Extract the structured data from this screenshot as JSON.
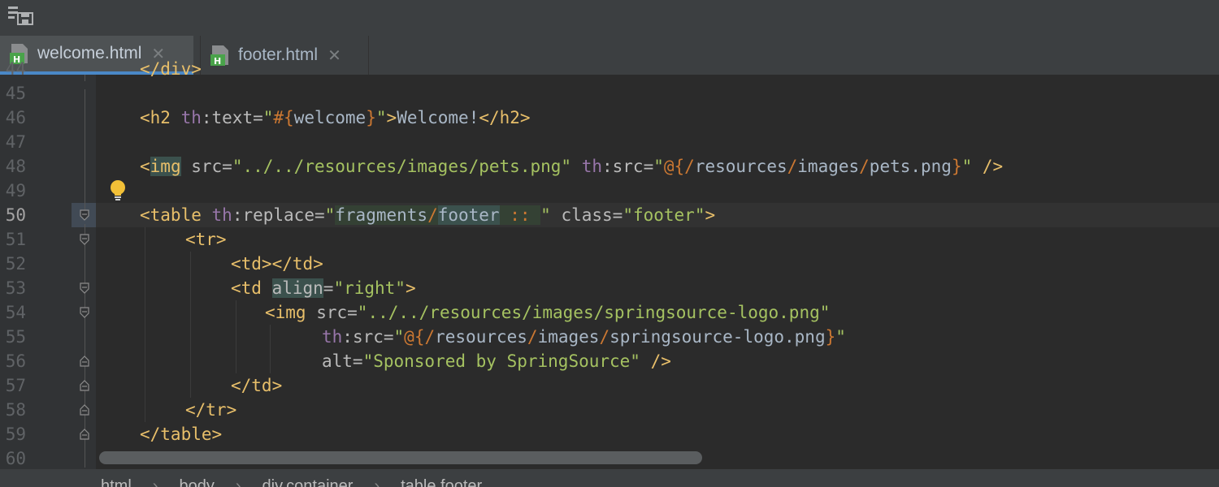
{
  "tabs": [
    {
      "label": "welcome.html",
      "active": true,
      "icon": "html-file-icon"
    },
    {
      "label": "footer.html",
      "active": false,
      "icon": "html-file-icon"
    }
  ],
  "gutter": {
    "line_numbers": [
      "45",
      "46",
      "47",
      "48",
      "49",
      "50",
      "51",
      "52",
      "53",
      "54",
      "55",
      "56",
      "57",
      "58",
      "59",
      "60"
    ],
    "current_line": "50",
    "partial_top_line": "44"
  },
  "code": {
    "partial_top": "</div>",
    "l46": {
      "t1": "<h2 ",
      "ns": "th",
      "a1": ":text=",
      "q1": "\"",
      "hash": "#",
      "brace_open": "{",
      "welcome": "welcome",
      "brace_close": "}",
      "q2": "\"",
      "t2": ">",
      "text": "Welcome!",
      "t3": "</h2>"
    },
    "l48": {
      "t1": "<",
      "img": "img",
      "a1": " src=",
      "s1": "\"../../resources/images/pets.png\"",
      "sp": " ",
      "ns": "th",
      "a2": ":src=",
      "q1": "\"",
      "at": "@{",
      "sl1": "/",
      "p1": "resources",
      "sl2": "/",
      "p2": "images",
      "sl3": "/",
      "p3": "pets.png",
      "bc": "}",
      "q2": "\"",
      "t2": " />"
    },
    "l50": {
      "t1": "<table ",
      "ns": "th",
      "a1": ":replace=",
      "q1": "\"",
      "p1": "fragments",
      "sl": "/",
      "p2": "footer",
      "dc": " :: ",
      "q2": "\"",
      "a2": " class=",
      "s2": "\"footer\"",
      "t2": ">"
    },
    "l51": "<tr>",
    "l52": "<td></td>",
    "l53": {
      "t1": "<td ",
      "a1": "align",
      "a2": "=",
      "s1": "\"right\"",
      "t2": ">"
    },
    "l54": {
      "t1": "<img ",
      "a1": "src=",
      "s1": "\"../../resources/images/springsource-logo.png\""
    },
    "l55": {
      "ns": "th",
      "a1": ":src=",
      "q1": "\"",
      "at": "@{",
      "sl1": "/",
      "p1": "resources",
      "sl2": "/",
      "p2": "images",
      "sl3": "/",
      "p3": "springsource-logo.png",
      "bc": "}",
      "q2": "\""
    },
    "l56": {
      "a1": "alt=",
      "s1": "\"Sponsored by SpringSource\"",
      "t1": " />"
    },
    "l57": "</td>",
    "l58": "</tr>",
    "l59": "</table>"
  },
  "breadcrumb": [
    "html",
    "body",
    "div.container",
    "table.footer"
  ],
  "colors": {
    "tag": "#e8bf6a",
    "string": "#a5c261",
    "namespace": "#9876aa",
    "keyword": "#cc7832",
    "accent": "#4a88c7"
  }
}
